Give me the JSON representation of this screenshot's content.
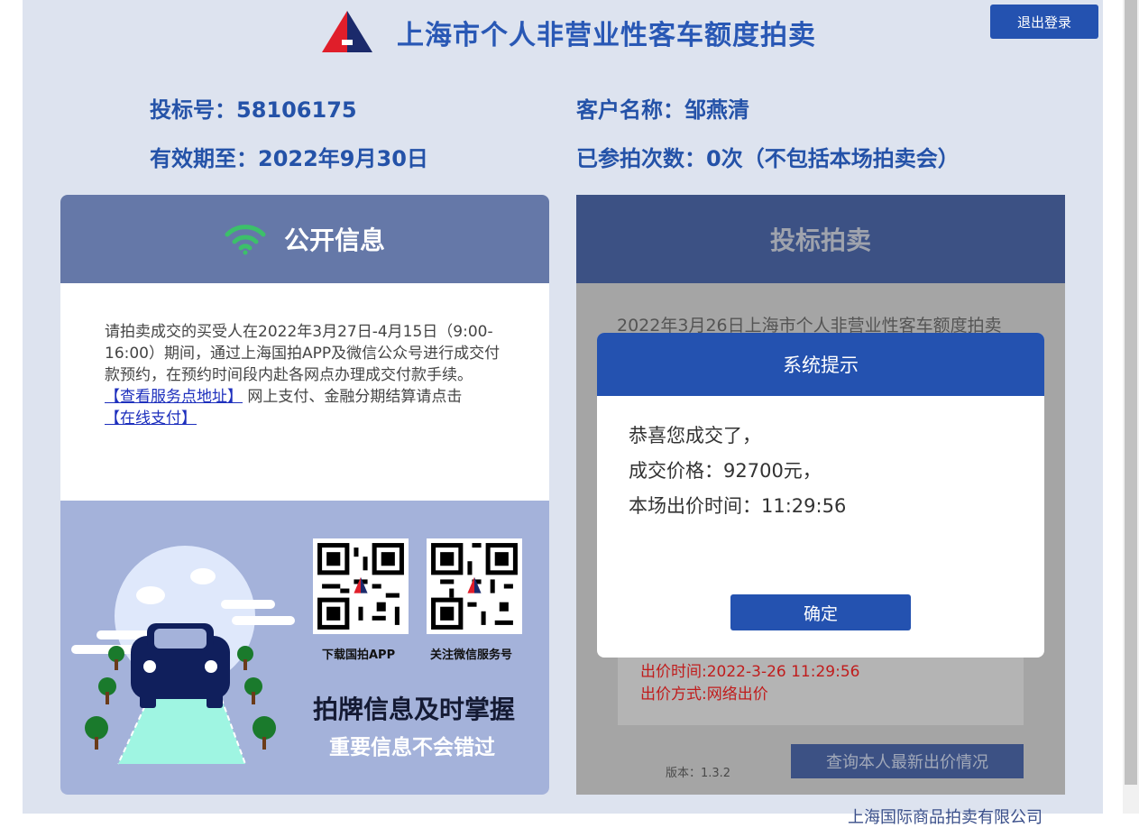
{
  "header": {
    "title": "上海市个人非营业性客车额度拍卖",
    "logout_label": "退出登录"
  },
  "bidder": {
    "bid_number": "投标号：58106175",
    "customer_name": "客户名称：邹燕清",
    "valid_until": "有效期至：2022年9月30日",
    "participation": "已参拍次数：0次（不包括本场拍卖会）"
  },
  "public_info": {
    "title": "公开信息",
    "notice": "请拍卖成交的买受人在2022年3月27日-4月15日（9:00-16:00）期间，通过上海国拍APP及微信公众号进行成交付款预约，在预约时间段内赴各网点办理成交付款手续。",
    "service_link": "【查看服务点地址】",
    "pay_text": "网上支付、金融分期结算请点击",
    "pay_link": "【在线支付】",
    "qr_app_label": "下载国拍APP",
    "qr_wechat_label": "关注微信服务号",
    "slogan_main": "拍牌信息及时掌握",
    "slogan_sub": "重要信息不会错过"
  },
  "auction": {
    "title": "投标拍卖",
    "auction_name": "2022年3月26日上海市个人非营业性客车额度拍卖",
    "bid_time": "出价时间:2022-3-26 11:29:56",
    "bid_method": "出价方式:网络出价",
    "version": "版本：1.3.2",
    "query_label": "查询本人最新出价情况"
  },
  "modal": {
    "title": "系统提示",
    "line1": "恭喜您成交了，",
    "line2": "成交价格：92700元，",
    "line3": "本场出价时间：11:29:56",
    "confirm_label": "确定"
  },
  "footer": {
    "company": "上海国际商品拍卖有限公司"
  },
  "colors": {
    "accent": "#2452b0",
    "frame_bg": "#dde3ef",
    "left_head": "#6578a8",
    "right_head": "#3c5184",
    "wifi": "#3cc06a",
    "bid_red": "#c01c1c"
  }
}
